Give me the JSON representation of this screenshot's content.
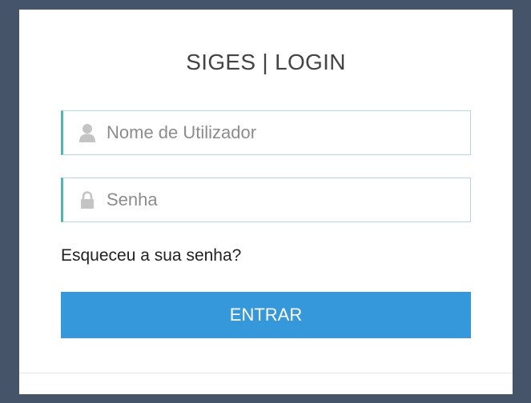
{
  "login": {
    "title": "SIGES | LOGIN",
    "username": {
      "value": "",
      "placeholder": "Nome de Utilizador",
      "icon": "user-icon"
    },
    "password": {
      "value": "",
      "placeholder": "Senha",
      "icon": "lock-icon"
    },
    "forgot_label": "Esqueceu a sua senha?",
    "submit_label": "ENTRAR"
  },
  "colors": {
    "page_background": "#46546a",
    "card_background": "#ffffff",
    "accent_border": "#52b6ad",
    "button": "#3498db",
    "icon": "#c4c4c4"
  }
}
